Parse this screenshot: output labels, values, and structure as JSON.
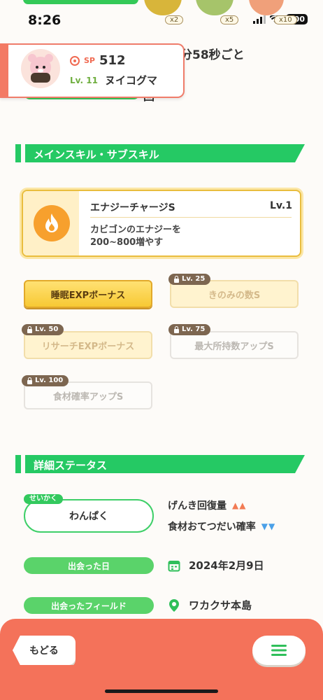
{
  "status_bar": {
    "time": "8:26",
    "battery": "100"
  },
  "header": {
    "interval_text": "分58秒ごと",
    "count_text": "回",
    "food_badges": [
      "x2",
      "x5",
      "x10"
    ]
  },
  "pokemon": {
    "sp_label": "SP",
    "sp_value": "512",
    "level": "Lv. 11",
    "name": "ヌイコグマ"
  },
  "skills_section": {
    "title": "メインスキル・サブスキル",
    "main_skill": {
      "name": "エナジーチャージS",
      "level": "Lv.1",
      "description_line1": "カビゴンのエナジーを",
      "description_line2": "200~800増やす",
      "icon": "flame-icon"
    },
    "sub_skills": [
      {
        "label": "睡眠EXPボーナス",
        "unlock": "",
        "state": "active"
      },
      {
        "label": "きのみの数S",
        "unlock": "Lv. 25",
        "state": "locked-yellow"
      },
      {
        "label": "リサーチEXPボーナス",
        "unlock": "Lv. 50",
        "state": "locked-yellow"
      },
      {
        "label": "最大所持数アップS",
        "unlock": "Lv. 75",
        "state": "locked-white"
      },
      {
        "label": "食材確率アップS",
        "unlock": "Lv. 100",
        "state": "locked-white"
      }
    ]
  },
  "details_section": {
    "title": "詳細ステータス",
    "nature_tag": "せいかく",
    "nature": "わんぱく",
    "effects": [
      {
        "label": "げんき回復量",
        "arrows": "▲▲"
      },
      {
        "label": "食材おてつだい確率",
        "arrows": "▼▼"
      }
    ],
    "met_date_label": "出会った日",
    "met_date": "2024年2月9日",
    "met_field_label": "出会ったフィールド",
    "met_field": "ワカクサ本島"
  },
  "bottom_bar": {
    "back_label": "もどる",
    "menu_icon": "hamburger-menu-icon"
  },
  "colors": {
    "accent_green": "#25c964",
    "coral": "#f4725a",
    "gold": "#e9bd3e"
  }
}
